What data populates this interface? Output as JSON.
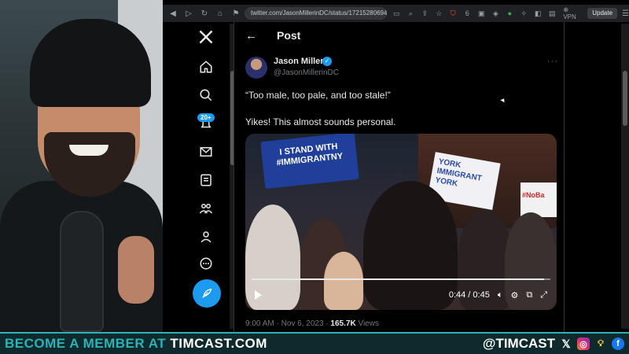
{
  "browser": {
    "url": "twitter.com/JasonMillerinDC/status/172152806946945...",
    "vpn_label": "VPN",
    "update_label": "Update",
    "shield_count": "6"
  },
  "x": {
    "notification_badge": "20+",
    "post_header": "Post"
  },
  "tweet": {
    "author_name": "Jason Miller",
    "handle": "@JasonMillerinDC",
    "line1": "“Too male, too pale, and too stale!”",
    "line2": "Yikes! This almost sounds personal.",
    "time": "9:00 AM",
    "date": "Nov 6, 2023",
    "views_count": "165.7K",
    "views_label": "Views"
  },
  "video": {
    "sign1_line1": "I STAND WITH",
    "sign1_line2": "#IMMIGRANTNY",
    "sign2_line1": "YORK",
    "sign2_line2": "IMMIGRANT",
    "sign2_line3": "YORK",
    "sign3_text": "#NoBa",
    "time_display": "0:44 / 0:45",
    "progress": 0.978
  },
  "bottom_bar": {
    "left_prefix": "BECOME A MEMBER AT ",
    "left_brand": "TIMCAST.COM",
    "handle": "@TIMCAST"
  },
  "colors": {
    "x_blue": "#1d9bf0",
    "teal_accent": "#2bb3b8"
  }
}
